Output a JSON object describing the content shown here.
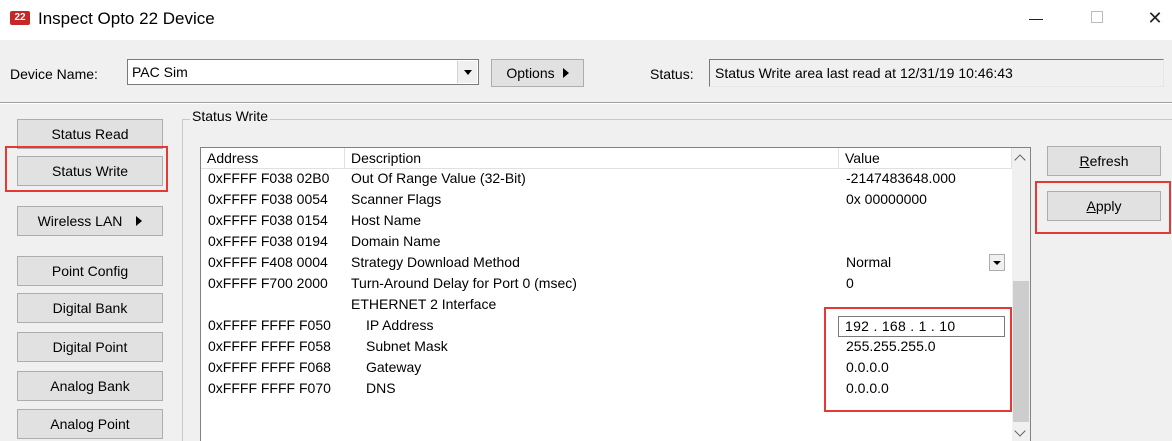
{
  "window": {
    "title": "Inspect Opto 22 Device",
    "icon_text": "22",
    "controls": {
      "minimize": "—",
      "maximize": "□",
      "close": "✕"
    }
  },
  "header": {
    "device_label": "Device Name:",
    "device_value": "PAC Sim",
    "options_label": "Options",
    "status_label": "Status:",
    "status_value": "Status Write area last read at 12/31/19 10:46:43"
  },
  "nav": {
    "items": [
      {
        "label": "Status Read",
        "selected": false,
        "has_submenu": false
      },
      {
        "label": "Status Write",
        "selected": true,
        "has_submenu": false
      },
      {
        "label": "Wireless LAN",
        "selected": false,
        "has_submenu": true
      },
      {
        "label": "Point Config",
        "selected": false,
        "has_submenu": false
      },
      {
        "label": "Digital Bank",
        "selected": false,
        "has_submenu": false
      },
      {
        "label": "Digital Point",
        "selected": false,
        "has_submenu": false
      },
      {
        "label": "Analog Bank",
        "selected": false,
        "has_submenu": false
      },
      {
        "label": "Analog Point",
        "selected": false,
        "has_submenu": false
      }
    ]
  },
  "group": {
    "title": "Status Write",
    "columns": [
      "Address",
      "Description",
      "Value"
    ],
    "rows": [
      {
        "address": "0xFFFF F038 02B0",
        "description": "Out Of Range Value (32-Bit)",
        "value": "-2147483648.000"
      },
      {
        "address": "0xFFFF F038 0054",
        "description": "Scanner Flags",
        "value": "0x 00000000"
      },
      {
        "address": "0xFFFF F038 0154",
        "description": "Host Name",
        "value": ""
      },
      {
        "address": "0xFFFF F038 0194",
        "description": "Domain Name",
        "value": ""
      },
      {
        "address": "0xFFFF F408 0004",
        "description": "Strategy Download Method",
        "value": "Normal"
      },
      {
        "address": "0xFFFF F700 2000",
        "description": "Turn-Around Delay for Port 0 (msec)",
        "value": "0"
      },
      {
        "address": "",
        "description": "ETHERNET 2 Interface",
        "value": ""
      },
      {
        "address": "0xFFFF FFFF F050",
        "description": "IP Address",
        "value": "192 . 168 . 1 . 10"
      },
      {
        "address": "0xFFFF FFFF F058",
        "description": "Subnet Mask",
        "value": "255.255.255.0"
      },
      {
        "address": "0xFFFF FFFF F068",
        "description": "Gateway",
        "value": "0.0.0.0"
      },
      {
        "address": "0xFFFF FFFF F070",
        "description": "DNS",
        "value": "0.0.0.0"
      }
    ]
  },
  "actions": {
    "refresh_label_first": "R",
    "refresh_label_rest": "efresh",
    "apply_label_first": "A",
    "apply_label_rest": "pply"
  },
  "colors": {
    "highlight_box": "#e53935",
    "dialog_bg": "#f0f0f0"
  }
}
